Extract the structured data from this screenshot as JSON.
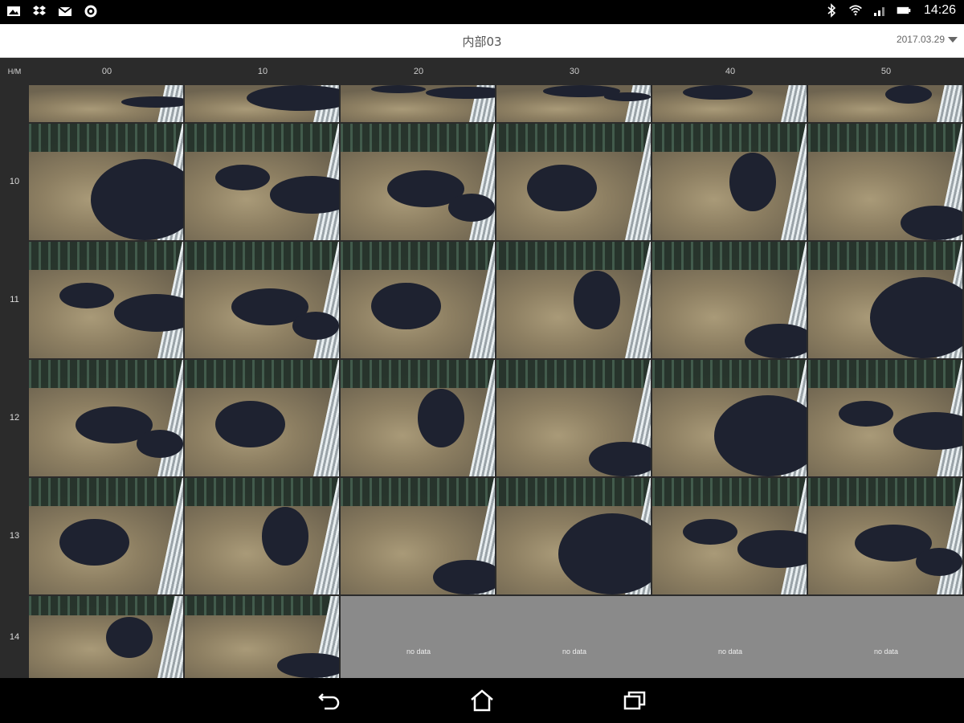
{
  "status_bar": {
    "left_icons": [
      "gallery-icon",
      "dropbox-icon",
      "mail-icon",
      "settings-sync-icon"
    ],
    "right_icons": [
      "bluetooth-icon",
      "wifi-icon",
      "signal-icon",
      "battery-icon"
    ],
    "time": "14:26"
  },
  "title_bar": {
    "title": "内部03",
    "date": "2017.03.29"
  },
  "grid": {
    "corner_label": "H/M",
    "minute_columns": [
      "00",
      "10",
      "20",
      "30",
      "40",
      "50"
    ],
    "hour_rows": [
      {
        "label": "",
        "cells": [
          "image",
          "image",
          "image",
          "image",
          "image",
          "image"
        ]
      },
      {
        "label": "10",
        "cells": [
          "image",
          "image",
          "image",
          "image",
          "image",
          "image"
        ]
      },
      {
        "label": "11",
        "cells": [
          "image",
          "image",
          "image",
          "image",
          "image",
          "image"
        ]
      },
      {
        "label": "12",
        "cells": [
          "image",
          "image",
          "image",
          "image",
          "image",
          "image"
        ]
      },
      {
        "label": "13",
        "cells": [
          "image",
          "image",
          "image",
          "image",
          "image",
          "image"
        ]
      },
      {
        "label": "14",
        "cells": [
          "image",
          "image",
          "no data",
          "no data",
          "no data",
          "no data"
        ]
      }
    ],
    "no_data_text": "no data"
  },
  "nav_bar": {
    "buttons": [
      "back-icon",
      "home-icon",
      "recents-icon"
    ]
  }
}
